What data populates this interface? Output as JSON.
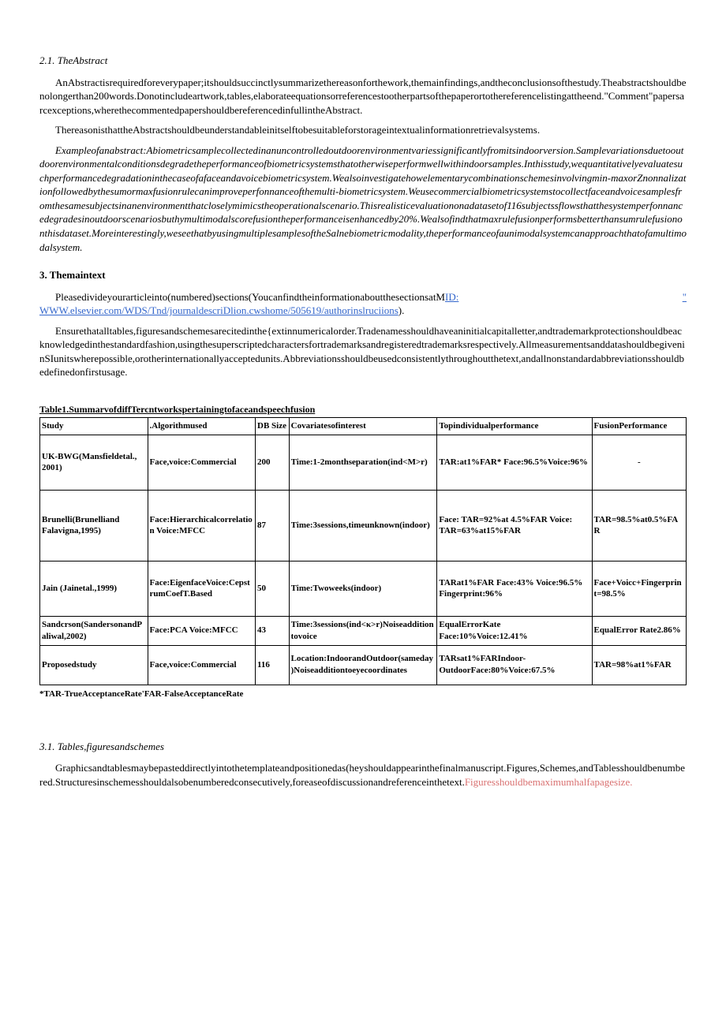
{
  "sec21": {
    "heading": "2.1.   TheAbstract",
    "p1": "AnAbstractisrequiredforeverypaper;itshouldsuccinctlysummarizethereasonforthework,themainfindings,andtheconclusionsofthestudy.Theabstractshouldbenolongerthan200words.Donotincludeartwork,tables,elaborateequationsorreferencestootherpartsofthepaperortothereferencelistingattheend.\"Comment\"papersarcexceptions,wherethecommentedpapershouldbereferencedinfullintheAbstract.",
    "p2": "ThereasonisthattheAbstractshouldbeunderstandableinitselftobesuitableforstorageintextualinformationretrievalsystems.",
    "example": "Exampleofanabstract:Abiometricsamplecollectedinanuncontrolledoutdoorenvironmentvariessignificantlyfromitsindoorversion.Samplevariationsduetooutdoorenvironmentalconditionsdegradetheperformanceofbiometricsystemsthatotherwiseperformwellwithindoorsamples.Inthisstudy,wequantitativelyevaluatesuchperformancedegradationinthecaseofafaceandavoicebiometricsystem.Wealsoinvestigatehowelementarycombinationschemesinvolvingmin-maxorZnonnalizationfollowedbythesumormaxfusionrulecanimproveperfonnanceofthemulti-biometricsystem.Weusecommercialbiometricsystemstocollectfaceandvoicesamplesfromthesamesubjectsinanenvironmentthatcloselymimicstheoperationalscenario.Thisrealisticevaluationonadatasetof116subjectssflowsthatthesystemperfonnancedegradesinoutdoorscenariosbuthymultimodalscorefusiontheperformanceisenhancedby20%.Wealsofindthatmaxrulefusionperformsbetterthansumrulefusiononthisdataset.Moreinterestingly,weseethatbyusingmultiplesamplesoftheSalnebiometricmodality,theperformanceofaunimodalsystemcanapproachthatofamultimodalsystem."
  },
  "sec3": {
    "heading": "3.   Themaintext",
    "p1_a": "Pleasedivideyourarticleinto(numbered)sections(YoucanfindtheinformationaboutthesectionsatM",
    "p1_link1": "ID:",
    "p1_link1b": "\"",
    "p1_link2": "WWW.elsevier.com/WDS/Tnd/journaldescriDlion.cwshome/505619/authorinslruciions",
    "p1_b": ").",
    "p2": "Ensurethatalltables,figuresandschemesarecitedinthe{extinnumericalorder.Tradenamesshouldhaveaninitialcapitalletter,andtrademarkprotectionshouldbeacknowledgedinthestandardfashion,usingthesuperscriptedcharactersfortrademarksandregisteredtrademarksrespectively.AllmeasurementsanddatashouldbegiveninSIunitswherepossible,orotherinternationallyacceptedunits.Abbreviationsshouldbeusedconsistentlythroughoutthetext,andallnonstandardabbreviationsshouldbedefinedonfirstusage."
  },
  "table1": {
    "caption": "Table1.SummarvofdiffTercntworkspertainingtofaceandspeechfusion",
    "headers": {
      "study": "Study",
      "algo": ".Algorithmused",
      "db": "DB Size",
      "cov": "Covariatesofinterest",
      "top": "Topindividualperformance",
      "fus": "FusionPerformance"
    },
    "rows": [
      {
        "study": "UK-BWG(Mansfieldetal., 2001)",
        "algo": "Face,voice:Commercial",
        "db": "200",
        "cov": "Time:1-2monthseparation(ind<M>r)",
        "top": "TAR:at1%FAR* Face:96.5%Voice:96%",
        "fus": "-"
      },
      {
        "study": "Brunelli(Brunelliand Falavigna,1995)",
        "algo": "Face:Hierarchicalcorrelation Voice:MFCC",
        "db": "87",
        "cov": "Time:3sessions,timeunknown(indoor)",
        "top": "Face: TAR=92%at 4.5%FAR Voice: TAR=63%at15%FAR",
        "fus": "TAR=98.5%at0.5%FAR"
      },
      {
        "study": "Jain (Jainetal.,1999)",
        "algo": "Face:EigenfaceVoice:CepstrumCoefT.Based",
        "db": "50",
        "cov": "Time:Twoweeks(indoor)",
        "top": "TARat1%FAR Face:43% Voice:96.5% Fingerprint:96%",
        "fus": "Face+Voicc+Fingerprint=98.5%"
      },
      {
        "study": "Sandcrson(SandersonandPaliwal,2002)",
        "algo": "Face:PCA Voice:MFCC",
        "db": "43",
        "cov": "Time:3sessions(ind<κ>r)Noiseadditiontovoice",
        "top": "EqualErrorKate Face:10%Voice:12.41%",
        "fus": "EqualError Rate2.86%"
      },
      {
        "study": "Proposedstudy",
        "algo": "Face,voice:Commercial",
        "db": "116",
        "cov": "Location:IndoorandOutdoor(sameday)Noiseadditiontoeyecoordinates",
        "top": "TARsat1%FARIndoor-OutdoorFace:80%Voice:67.5%",
        "fus": "TAR=98%at1%FAR"
      }
    ],
    "footnote": "*TAR-TrueAcceptanceRate'FAR-FalseAcceptanceRate"
  },
  "sec31": {
    "heading": "3.1.   Tables,figuresandschemes",
    "p1_a": "Graphicsandtablesmaybepasteddirectlyintothetemplateandpositionedas(heyshouldappearinthefinalmanuscript.Figures,Schemes,andTablesshouldbenumbered.Structuresinschemesshouldalsobenumberedconsecutively,foreaseofdiscussionandreferenceinthetext.",
    "p1_highlight": "Figuresshouldbemaximumhalfapagesize."
  }
}
